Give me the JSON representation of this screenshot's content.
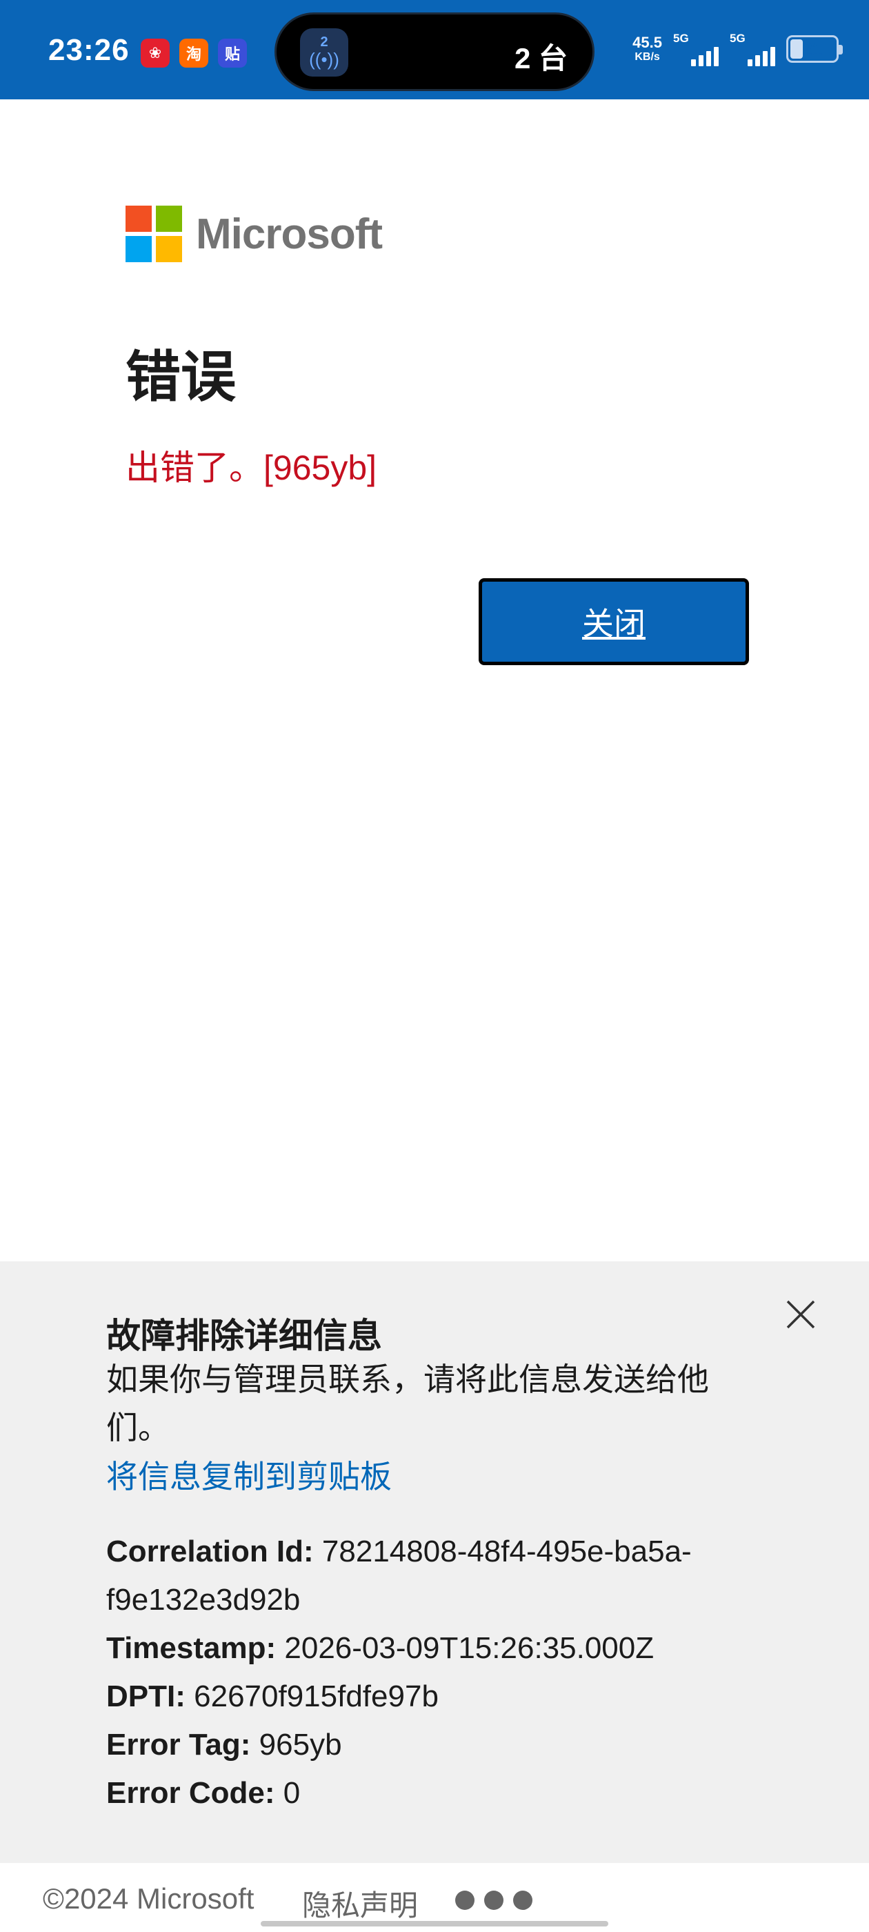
{
  "status_bar": {
    "time": "23:26",
    "notif_icons": [
      {
        "name": "xiaohongshu-app-icon",
        "glyph": "❀",
        "color": "#e4202e"
      },
      {
        "name": "taobao-app-icon",
        "glyph": "淘",
        "color": "#ff6a00"
      },
      {
        "name": "tieba-app-icon",
        "glyph": "贴",
        "color": "#3b4fd9"
      }
    ],
    "hotspot_count": "2",
    "hotspot_glyph": "((•))",
    "devices_label": "2 台",
    "net_speed": "45.5",
    "net_speed_unit": "KB/s",
    "sim1_label": "5G",
    "sim2_label": "5G",
    "battery": "21"
  },
  "brand": {
    "name": "Microsoft",
    "colors": {
      "red": "#f25022",
      "green": "#7fba00",
      "blue": "#00a4ef",
      "yellow": "#ffb900"
    }
  },
  "main": {
    "title": "错误",
    "error_message": "出错了。[965yb]",
    "close_button": "关闭"
  },
  "troubleshooting": {
    "title": "故障排除详细信息",
    "description": "如果你与管理员联系，请将此信息发送给他们。",
    "copy_link": "将信息复制到剪贴板",
    "details": [
      {
        "label": "Correlation Id:",
        "value": "78214808-48f4-495e-ba5a-f9e132e3d92b"
      },
      {
        "label": "Timestamp:",
        "value": "2026-03-09T15:26:35.000Z"
      },
      {
        "label": "DPTI:",
        "value": "62670f915fdfe97b"
      },
      {
        "label": "Error Tag:",
        "value": "965yb"
      },
      {
        "label": "Error Code:",
        "value": "0"
      }
    ]
  },
  "footer": {
    "copyright": "©2024 Microsoft",
    "privacy": "隐私声明"
  },
  "colors": {
    "status_bar_bg": "#0a65b7",
    "primary_button": "#0a65b7",
    "error_text": "#c50f1f",
    "link": "#0067b8",
    "panel_bg": "#f0f0f0"
  }
}
